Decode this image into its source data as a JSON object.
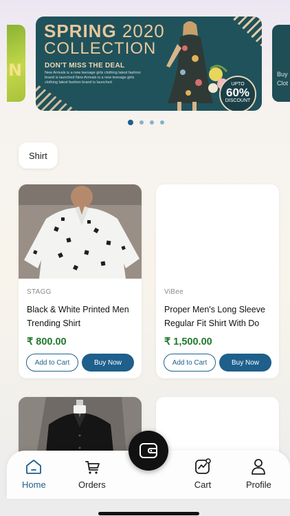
{
  "banner": {
    "title_bold": "SPRING",
    "title_year": "2020",
    "title_line2": "COLLECTION",
    "tagline": "DON'T MISS THE DEAL",
    "blurb": "New Arrivals is a new teenage girls clothing latest fashion brand is launched New Arrivals is a new teenage girls clothing latest fashion brand is launched",
    "badge_top": "UPTO",
    "badge_value": "60%",
    "badge_bottom": "DISCOUNT",
    "peek_left_letter": "N",
    "peek_right_text": "Buy Clot"
  },
  "carousel": {
    "total_slides": 4,
    "active_index": 0
  },
  "category_chip": {
    "label": "Shirt"
  },
  "products": [
    {
      "brand": "STAGG",
      "name": "Black & White Printed Men Trending Shirt",
      "price": "₹ 800.00",
      "add_to_cart": "Add to Cart",
      "buy_now": "Buy Now"
    },
    {
      "brand": "ViBee",
      "name": "Proper Men's Long Sleeve Regular Fit Shirt With Do",
      "price": "₹ 1,500.00",
      "add_to_cart": "Add to Cart",
      "buy_now": "Buy Now"
    }
  ],
  "nav": {
    "items": [
      {
        "label": "Home",
        "icon": "home-icon",
        "active": true
      },
      {
        "label": "Orders",
        "icon": "orders-icon"
      },
      {
        "label": "Cart",
        "icon": "cart-icon"
      },
      {
        "label": "Profile",
        "icon": "profile-icon"
      }
    ],
    "center_button_icon": "wallet-icon"
  },
  "colors": {
    "primary": "#1e5f8c",
    "price_green": "#217a2d",
    "banner_teal": "#20525b"
  }
}
